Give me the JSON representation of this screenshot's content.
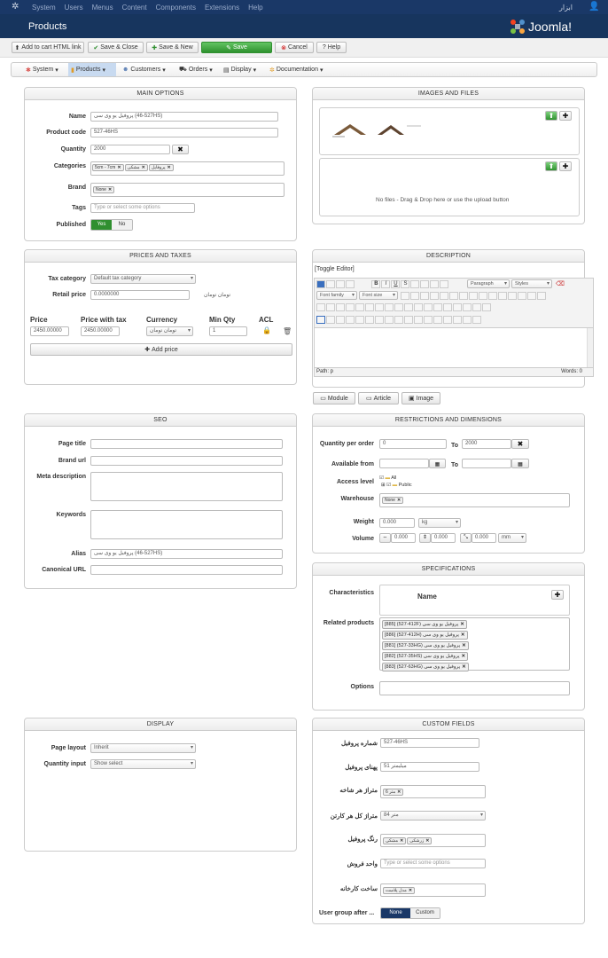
{
  "topbar": {
    "menu": [
      "System",
      "Users",
      "Menus",
      "Content",
      "Components",
      "Extensions",
      "Help"
    ],
    "right_text": "ابزار"
  },
  "header": {
    "title": "Products",
    "logo_text": "Joomla!"
  },
  "toolbar": {
    "add_to_cart": "Add to cart HTML link",
    "save_close": "Save & Close",
    "save_new": "Save & New",
    "save": "Save",
    "cancel": "Cancel",
    "help": "Help"
  },
  "submenu": [
    {
      "label": "System",
      "active": false
    },
    {
      "label": "Products",
      "active": true
    },
    {
      "label": "Customers",
      "active": false
    },
    {
      "label": "Orders",
      "active": false
    },
    {
      "label": "Display",
      "active": false
    },
    {
      "label": "Documentation",
      "active": false
    }
  ],
  "main_options": {
    "heading": "MAIN OPTIONS",
    "name_label": "Name",
    "name_value": "پروفیل یو وی سی (527-46HS)",
    "code_label": "Product code",
    "code_value": "527-46HS",
    "qty_label": "Quantity",
    "qty_value": "2000",
    "cat_label": "Categories",
    "categories": [
      "5cm - 7cm",
      "مشکی",
      "پروفایل"
    ],
    "brand_label": "Brand",
    "brand_value": "None",
    "tags_label": "Tags",
    "tags_placeholder": "Type or select some options",
    "pub_label": "Published",
    "yes": "Yes",
    "no": "No"
  },
  "prices": {
    "heading": "PRICES AND TAXES",
    "tax_label": "Tax category",
    "tax_value": "Default tax category",
    "retail_label": "Retail price",
    "retail_value": "0.0000000",
    "retail_currency": "تومان تومان",
    "col_price": "Price",
    "col_pwt": "Price with tax",
    "col_currency": "Currency",
    "col_minqty": "Min Qty",
    "col_acl": "ACL",
    "row_price": "2450.00000",
    "row_pwt": "2450.00000",
    "row_currency": "تومان تومان",
    "row_minqty": "1",
    "add_price": "Add price"
  },
  "images": {
    "heading": "IMAGES AND FILES",
    "no_files": "No files - Drag & Drop here or use the upload button"
  },
  "description": {
    "heading": "DESCRIPTION",
    "toggle": "[Toggle Editor]",
    "paragraph": "Paragraph",
    "styles": "Styles",
    "font_family": "Font family",
    "font_size": "Font size",
    "path": "Path: p",
    "words": "Words: 0",
    "module": "Module",
    "article": "Article",
    "image": "Image"
  },
  "seo": {
    "heading": "SEO",
    "page_title": "Page title",
    "brand_url": "Brand url",
    "meta": "Meta description",
    "keywords": "Keywords",
    "alias_label": "Alias",
    "alias_value": "پروفیل یو وی سی (527-46HS)",
    "canonical": "Canonical URL"
  },
  "restrictions": {
    "heading": "RESTRICTIONS AND DIMENSIONS",
    "qpo_label": "Quantity per order",
    "qpo_from": "0",
    "to": "To",
    "qpo_to": "2000",
    "avail_label": "Available from",
    "access_label": "Access level",
    "access_all": "All",
    "access_public": "Public",
    "warehouse_label": "Warehouse",
    "warehouse_value": "None",
    "weight_label": "Weight",
    "weight_value": "0.000",
    "weight_unit": "kg",
    "volume_label": "Volume",
    "vol1": "0.000",
    "vol2": "0.000",
    "vol3": "0.000",
    "vol_unit": "mm"
  },
  "specs": {
    "heading": "SPECIFICATIONS",
    "char_label": "Characteristics",
    "name_col": "Name",
    "related_label": "Related products",
    "related": [
      "[885] (527-412F) پروفیل یو وی سی",
      "[886] (527-412H) پروفیل یو وی سی",
      "[881] (527-33HG) پروفیل یو وی سی",
      "[882] (527-35HS) پروفیل یو وی سی",
      "[883] (527-63HG) پروفیل یو وی سی"
    ],
    "options_label": "Options"
  },
  "display": {
    "heading": "DISPLAY",
    "layout_label": "Page layout",
    "layout_value": "Inherit",
    "qtyinput_label": "Quantity input",
    "qtyinput_value": "Show select"
  },
  "custom": {
    "heading": "CUSTOM FIELDS",
    "f1_label": "شماره پروفیل",
    "f1_value": "527-46HS",
    "f2_label": "پهنای پروفیل",
    "f2_value": "51 میلیمتر",
    "f3_label": "متراژ هر شاخه",
    "f3_tag": "6 متر",
    "f4_label": "متراژ کل هر کارتن",
    "f4_value": "84 متر",
    "f5_label": "رنگ پروفیل",
    "f5_tags": [
      "مشکی",
      "زرشکی"
    ],
    "f6_label": "واحد فروش",
    "f6_placeholder": "Type or select some options",
    "f7_label": "ساخت کارخانه",
    "f7_tag": "مدل پلاست",
    "ug_label": "User group after ...",
    "none": "None",
    "customb": "Custom"
  }
}
